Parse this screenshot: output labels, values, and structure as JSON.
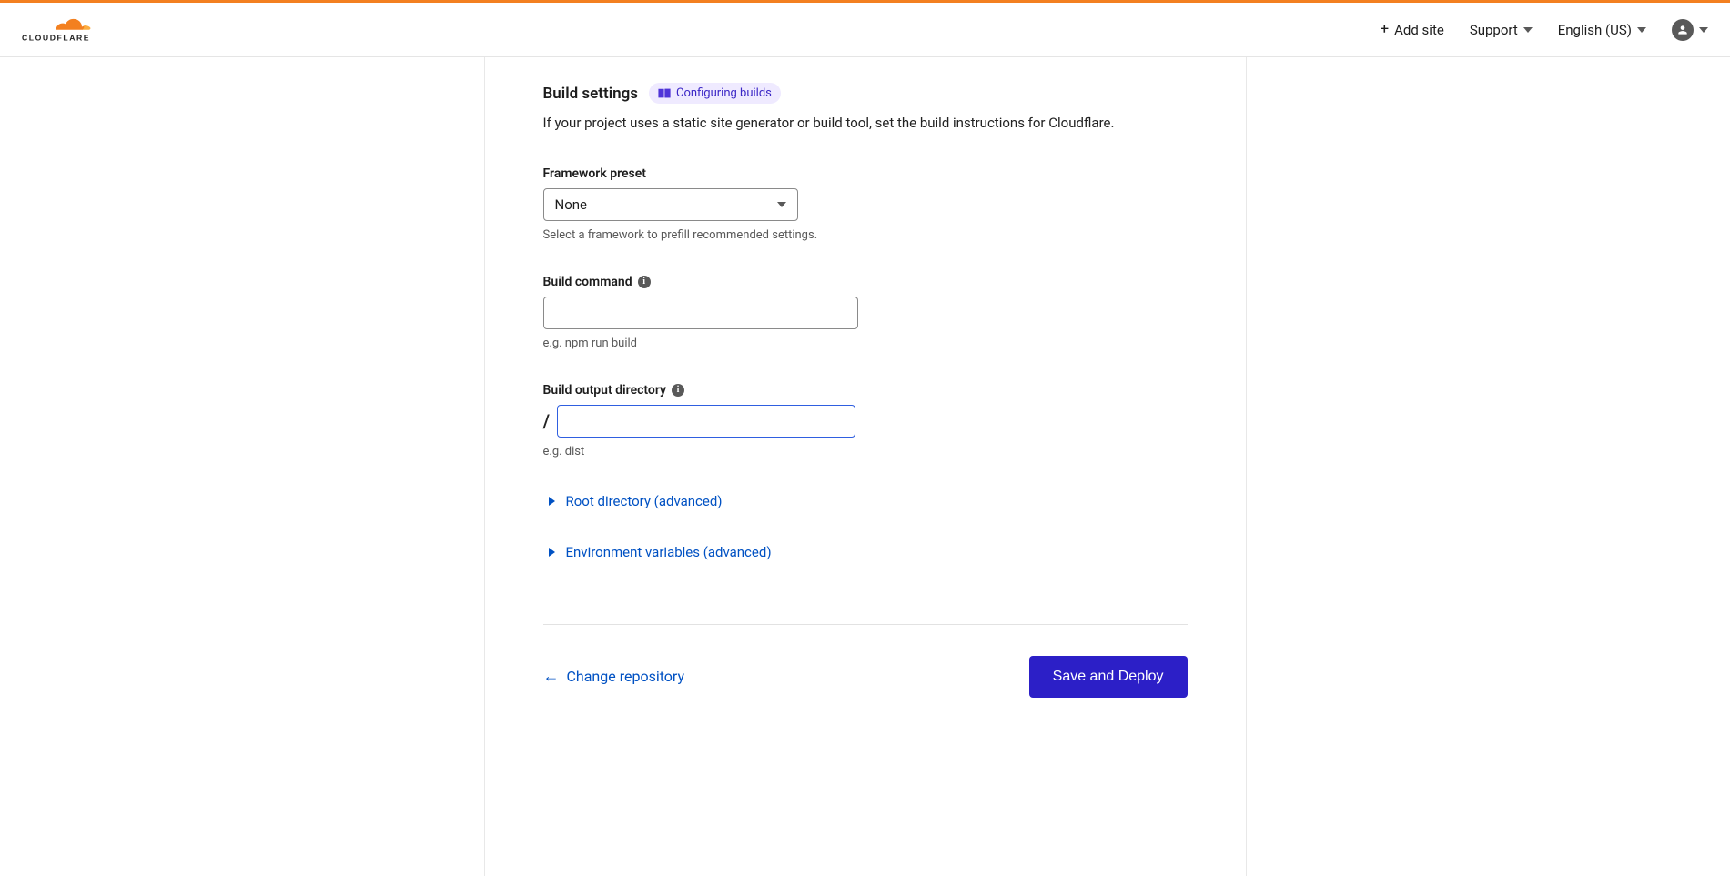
{
  "header": {
    "add_site": "Add site",
    "support": "Support",
    "language": "English (US)"
  },
  "build": {
    "title": "Build settings",
    "badge_label": "Configuring builds",
    "description": "If your project uses a static site generator or build tool, set the build instructions for Cloudflare."
  },
  "framework": {
    "label": "Framework preset",
    "value": "None",
    "helper": "Select a framework to prefill recommended settings."
  },
  "command": {
    "label": "Build command",
    "value": "",
    "helper": "e.g. npm run build"
  },
  "output": {
    "label": "Build output directory",
    "prefix": "/",
    "value": "",
    "helper": "e.g. dist"
  },
  "expanders": {
    "root": "Root directory (advanced)",
    "env": "Environment variables (advanced)"
  },
  "footer": {
    "back": "Change repository",
    "deploy": "Save and Deploy"
  }
}
